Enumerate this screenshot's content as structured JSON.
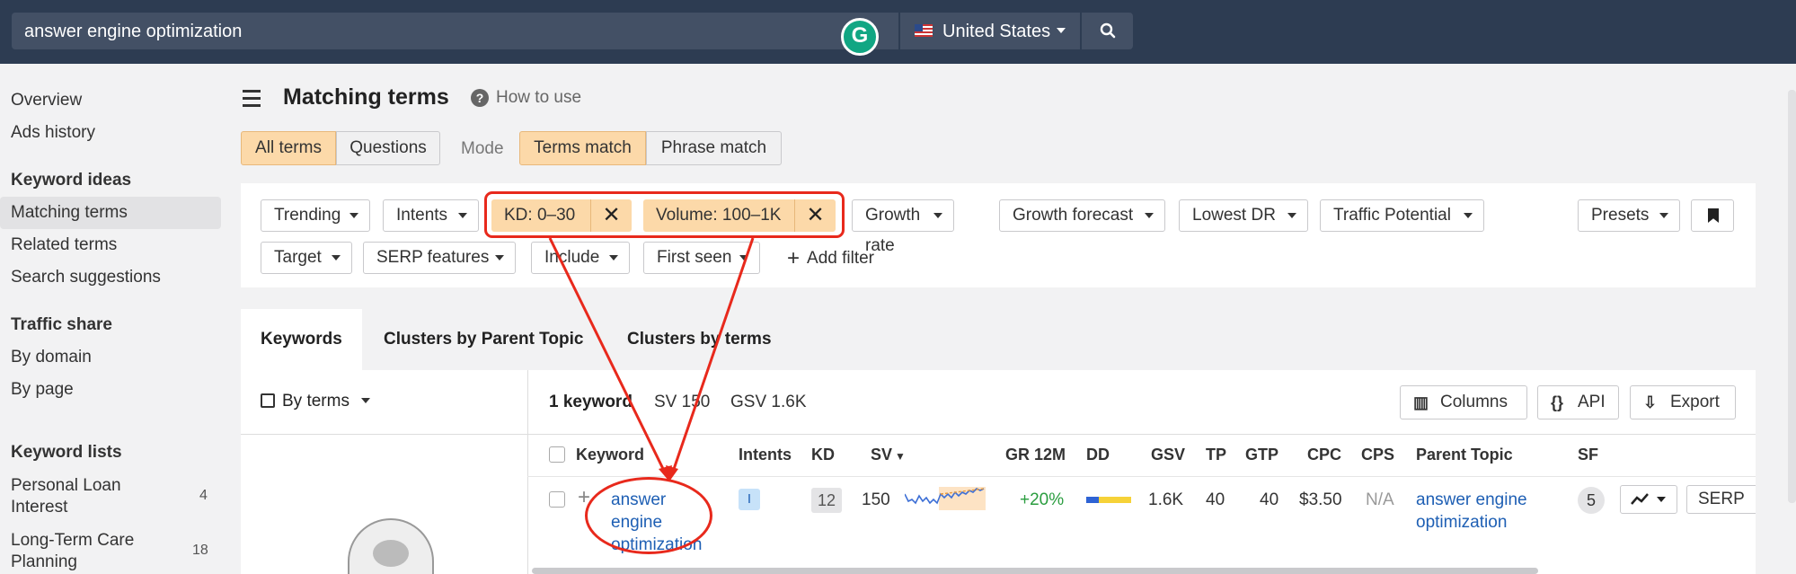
{
  "topbar": {
    "search_value": "answer engine optimization",
    "grammarly_letter": "G",
    "country": "United States",
    "search_icon": "search-icon"
  },
  "sidebar": {
    "overview": "Overview",
    "ads_history": "Ads history",
    "keyword_ideas": "Keyword ideas",
    "matching_terms": "Matching terms",
    "related_terms": "Related terms",
    "search_suggestions": "Search suggestions",
    "traffic_share": "Traffic share",
    "by_domain": "By domain",
    "by_page": "By page",
    "keyword_lists": "Keyword lists",
    "list1_line1": "Personal Loan",
    "list1_line2": "Interest",
    "list1_count": "4",
    "list2_line1": "Long-Term Care",
    "list2_line2": "Planning",
    "list2_count": "18"
  },
  "header": {
    "title": "Matching terms",
    "how_to_use": "How to use",
    "all_terms": "All terms",
    "questions": "Questions",
    "mode": "Mode",
    "terms_match": "Terms match",
    "phrase_match": "Phrase match"
  },
  "filters": {
    "trending": "Trending",
    "intents": "Intents",
    "kd": "KD: 0–30",
    "volume": "Volume: 100–1K",
    "growth_rate": "Growth rate",
    "growth_forecast": "Growth forecast",
    "lowest_dr": "Lowest DR",
    "traffic_potential": "Traffic Potential",
    "presets": "Presets",
    "target": "Target",
    "serp_features": "SERP features",
    "include": "Include",
    "first_seen": "First seen",
    "add_filter": "Add filter"
  },
  "tabs": {
    "keywords": "Keywords",
    "clusters_parent": "Clusters by Parent Topic",
    "clusters_terms": "Clusters by terms"
  },
  "summary": {
    "by_terms": "By terms",
    "count": "1 keyword",
    "sv": "SV 150",
    "gsv": "GSV 1.6K",
    "columns": "Columns",
    "api": "API",
    "api_icon": "{}",
    "export": "Export"
  },
  "table": {
    "headers": {
      "keyword": "Keyword",
      "intents": "Intents",
      "kd": "KD",
      "sv": "SV",
      "gr": "GR 12M",
      "dd": "DD",
      "gsv": "GSV",
      "tp": "TP",
      "gtp": "GTP",
      "cpc": "CPC",
      "cps": "CPS",
      "parent_topic": "Parent Topic",
      "sf": "SF"
    },
    "row": {
      "keyword_l1": "answer",
      "keyword_l2": "engine",
      "keyword_l3": "optimization",
      "intent": "I",
      "kd": "12",
      "sv": "150",
      "gr": "+20%",
      "gsv": "1.6K",
      "tp": "40",
      "gtp": "40",
      "cpc": "$3.50",
      "cps": "N/A",
      "parent_l1": "answer engine",
      "parent_l2": "optimization",
      "sf": "5",
      "serp": "SERP"
    }
  },
  "colors": {
    "topbar": "#2d3c52",
    "accent_chip": "#fcd9a9",
    "link": "#1e5fb4",
    "annotation": "#e8291c",
    "positive": "#2a9d3f"
  }
}
